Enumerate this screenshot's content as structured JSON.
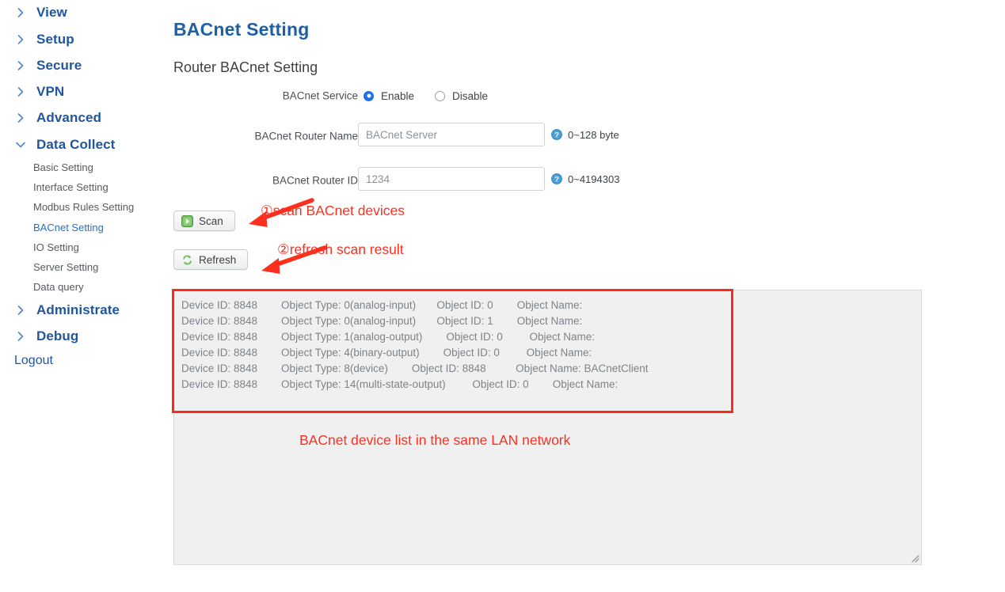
{
  "sidebar": {
    "top_items": [
      {
        "label": "View",
        "icon": "chevron-right-icon",
        "expanded": false
      },
      {
        "label": "Setup",
        "icon": "chevron-right-icon",
        "expanded": false
      },
      {
        "label": "Secure",
        "icon": "chevron-right-icon",
        "expanded": false
      },
      {
        "label": "VPN",
        "icon": "chevron-right-icon",
        "expanded": false
      },
      {
        "label": "Advanced",
        "icon": "chevron-right-icon",
        "expanded": false
      },
      {
        "label": "Data Collect",
        "icon": "chevron-down-icon",
        "expanded": true
      }
    ],
    "sub_items": [
      {
        "label": "Basic Setting",
        "active": false
      },
      {
        "label": "Interface Setting",
        "active": false
      },
      {
        "label": "Modbus Rules Setting",
        "active": false
      },
      {
        "label": "BACnet Setting",
        "active": true
      },
      {
        "label": "IO Setting",
        "active": false
      },
      {
        "label": "Server Setting",
        "active": false
      },
      {
        "label": "Data query",
        "active": false
      }
    ],
    "bottom_items": [
      {
        "label": "Administrate",
        "icon": "chevron-right-icon",
        "expanded": false
      },
      {
        "label": "Debug",
        "icon": "chevron-right-icon",
        "expanded": false
      }
    ],
    "logout_label": "Logout",
    "active_color": "#2571c7",
    "heading_color": "#21569e"
  },
  "main": {
    "page_title": "BACnet Setting",
    "section_title": "Router BACnet Setting",
    "title_color": "#1f5fa8",
    "form": {
      "service": {
        "label": "BACnet Service",
        "options": [
          {
            "label": "Enable",
            "selected": true
          },
          {
            "label": "Disable",
            "selected": false
          }
        ]
      },
      "router_name": {
        "label": "BACnet Router Name",
        "value": "",
        "placeholder": "BACnet Server",
        "hint": "0~128 byte",
        "hint_icon": "help-question-icon"
      },
      "router_id": {
        "label": "BACnet Router ID",
        "value": "",
        "placeholder": "1234",
        "hint": "0~4194303",
        "hint_icon": "help-question-icon"
      }
    },
    "buttons": {
      "scan": {
        "label": "Scan",
        "icon": "green-play-square-icon"
      },
      "refresh": {
        "label": "Refresh",
        "icon": "green-refresh-arrows-icon"
      }
    },
    "result": {
      "background_color": "#f0f0f0",
      "text_color": "#7d8388",
      "lines": [
        "Device ID: 8848        Object Type: 0(analog-input)       Object ID: 0        Object Name:",
        "Device ID: 8848        Object Type: 0(analog-input)       Object ID: 1        Object Name:",
        "Device ID: 8848        Object Type: 1(analog-output)        Object ID: 0         Object Name:",
        "Device ID: 8848        Object Type: 4(binary-output)        Object ID: 0         Object Name:",
        "Device ID: 8848        Object Type: 8(device)        Object ID: 8848          Object Name: BACnetClient",
        "Device ID: 8848        Object Type: 14(multi-state-output)         Object ID: 0        Object Name:"
      ],
      "resize_handle_icon": "resize-grip-icon"
    }
  },
  "annotations": {
    "color": "#fd3020",
    "scan_note": "①scan BACnet devices",
    "refresh_note": "②refresh scan result",
    "list_caption": "BACnet device list in the same LAN network",
    "arrow_icon": "red-arrow-left-icon",
    "box_icon": "red-highlight-box"
  }
}
